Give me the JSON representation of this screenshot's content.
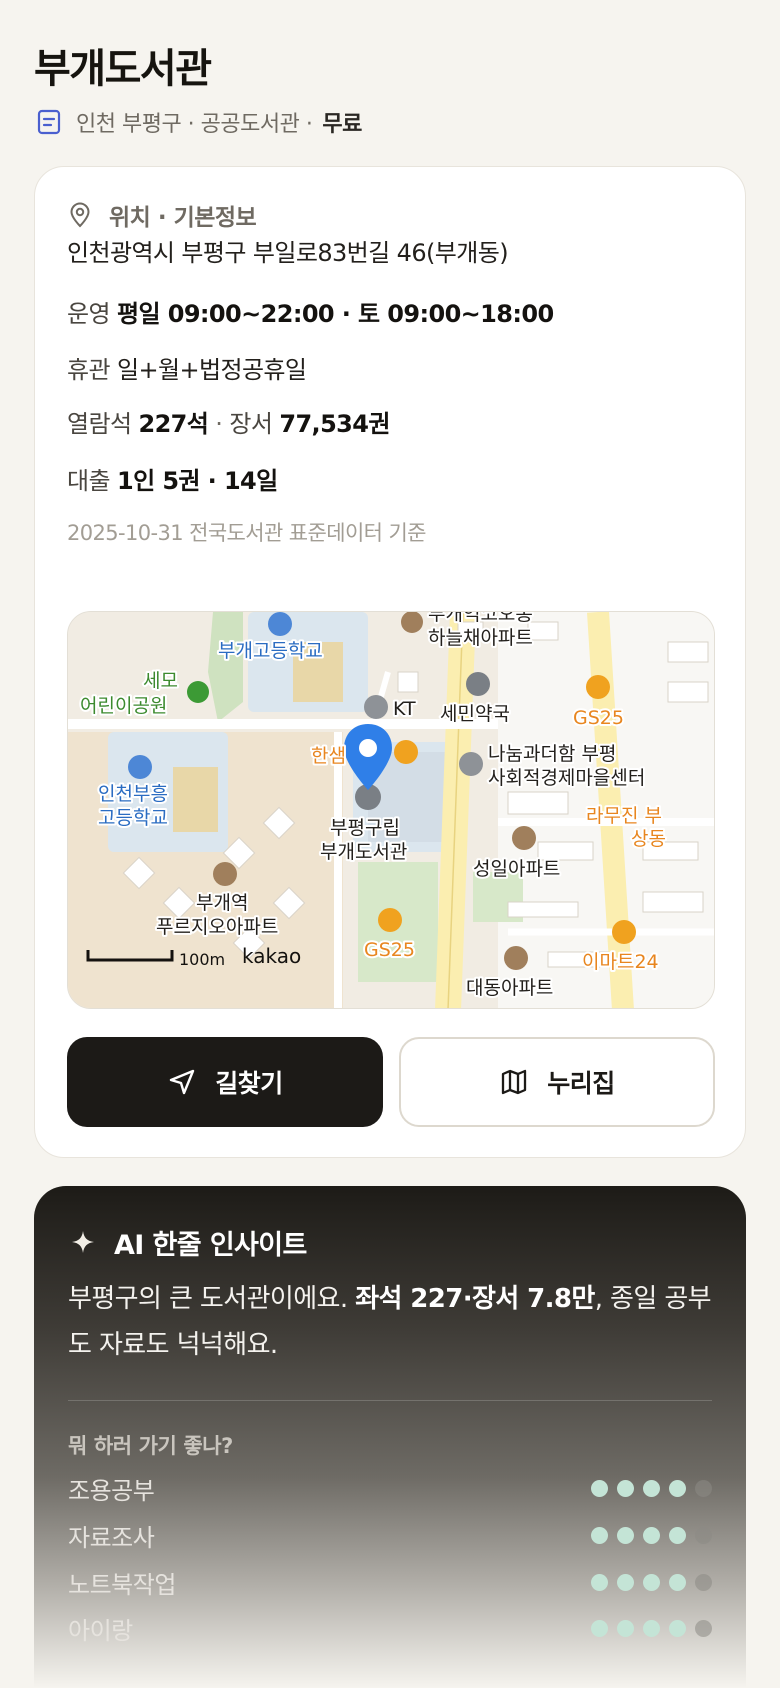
{
  "header": {
    "title": "부개도서관",
    "subtitle": "인천 부평구 · 공공도서관 · ",
    "fee": "무료"
  },
  "info": {
    "section_title": "위치 · 기본정보",
    "address": "인천광역시 부평구 부일로83번길 46(부개동)",
    "hours_label": "운영",
    "hours_value": "평일 09:00~22:00 · 토 09:00~18:00",
    "closed_label": "휴관",
    "closed_value": "일+월+법정공휴일",
    "seats_label": "열람석",
    "seats_value": "227석",
    "sep": "·",
    "books_label": "장서",
    "books_value": "77,534권",
    "loan_label": "대출",
    "loan_value": "1인 5권 · 14일",
    "data_source": "2025-10-31 전국도서관 표준데이터 기준"
  },
  "map": {
    "labels": {
      "school1": "부개고등학교",
      "park1": "세모",
      "park2": "어린이공원",
      "kt": "KT",
      "pharmacy": "세민약국",
      "gs25_top": "GS25",
      "hansam": "한샘",
      "center1": "나눔과더함 부평",
      "center2": "사회적경제마을센터",
      "school2a": "인천부흥",
      "school2b": "고등학교",
      "library1": "부평구립",
      "library2": "부개도서관",
      "lamujin1": "라무진 부",
      "lamujin2": "상동",
      "apt_top1": "부개역코오롱",
      "apt_top2": "하늘채아파트",
      "apt_sungil": "성일아파트",
      "apt_purgio1": "부개역",
      "apt_purgio2": "푸르지오아파트",
      "gs25_bottom": "GS25",
      "emart": "이마트24",
      "apt_bottom": "대동아파트",
      "scale": "100m",
      "brand": "kakao"
    },
    "colors": {
      "pin": "#2f7fe8",
      "school": "#2a6cc2",
      "park": "#3c8a2e",
      "store": "#e8861f"
    }
  },
  "actions": {
    "directions": "길찾기",
    "homepage": "누리집"
  },
  "ai": {
    "title": "AI 한줄 인사이트",
    "text_1": "부평구의 큰 도서관이에요. ",
    "text_bold": "좌석 227·장서 7.8만",
    "text_2": ", 종일 공부도 자료도 넉넉해요.",
    "question": "뭐 하러 가기 좋나?",
    "scores": [
      {
        "label": "조용공부",
        "value": 4,
        "max": 5
      },
      {
        "label": "자료조사",
        "value": 4,
        "max": 5
      },
      {
        "label": "노트북작업",
        "value": 4,
        "max": 5
      },
      {
        "label": "아이랑",
        "value": 4,
        "max": 5
      }
    ]
  }
}
